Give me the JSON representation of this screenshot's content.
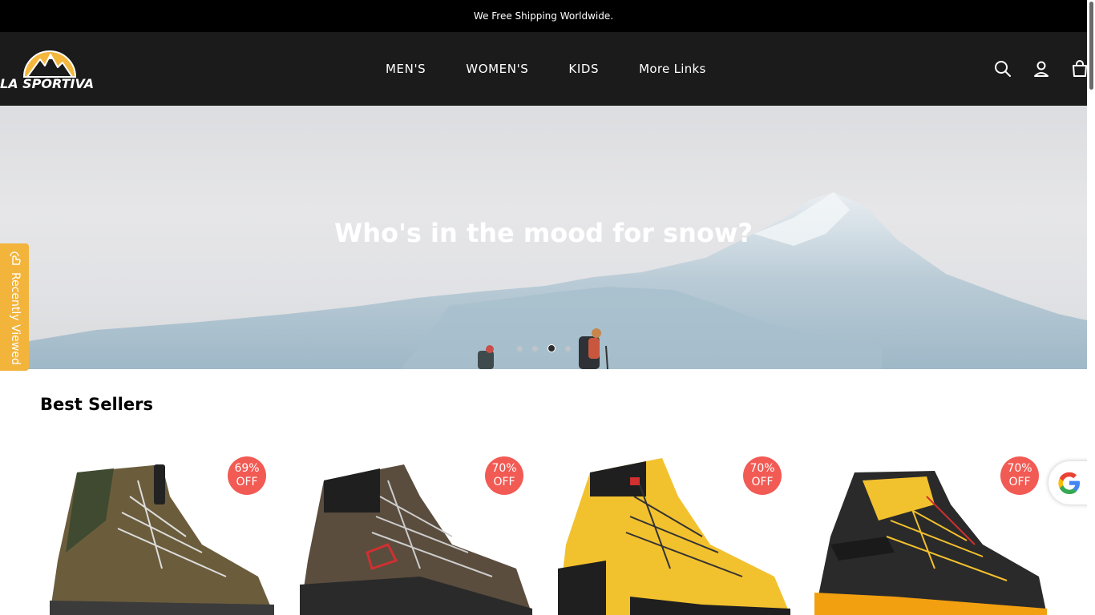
{
  "announcement": {
    "text": "We Free Shipping Worldwide."
  },
  "header": {
    "logo_text": "LA SPORTIVA",
    "nav": [
      {
        "label": "MEN'S"
      },
      {
        "label": "WOMEN'S"
      },
      {
        "label": "KIDS"
      },
      {
        "label": "More Links"
      }
    ],
    "icons": [
      "search-icon",
      "account-icon",
      "cart-icon"
    ]
  },
  "hero": {
    "title": "Who's in the mood for snow?",
    "slides_count": 4,
    "active_slide": 3
  },
  "recently_viewed": {
    "label": "Recently Viewed",
    "icon": "hand-tap-icon"
  },
  "best_sellers": {
    "title": "Best Sellers",
    "products": [
      {
        "badge_pct": "69%",
        "badge_off": "OFF",
        "boot_color": "olive"
      },
      {
        "badge_pct": "70%",
        "badge_off": "OFF",
        "boot_color": "brown"
      },
      {
        "badge_pct": "70%",
        "badge_off": "OFF",
        "boot_color": "yellow"
      },
      {
        "badge_pct": "70%",
        "badge_off": "OFF",
        "boot_color": "black-yellow"
      }
    ]
  },
  "colors": {
    "announce_bg": "#000000",
    "header_bg": "#1b1b1b",
    "badge": "#f25a54",
    "recent_tab": "#f3b43c"
  }
}
